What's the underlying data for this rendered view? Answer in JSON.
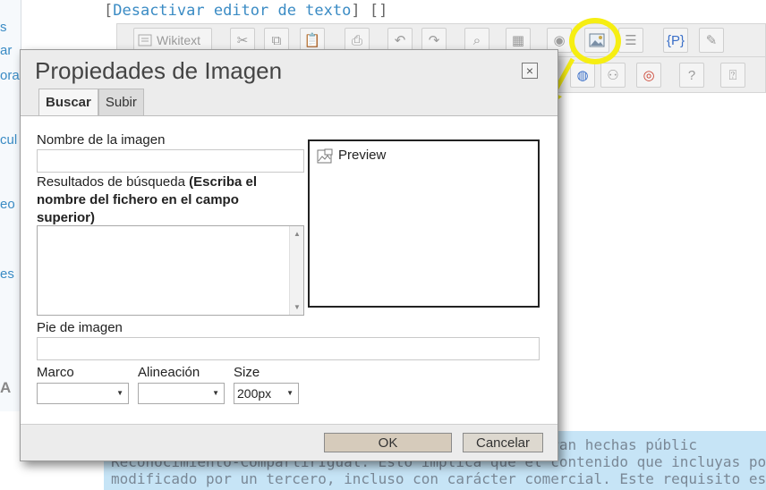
{
  "background": {
    "top_links": {
      "link": "Desactivar editor de texto",
      "open": "[",
      "close": "] []"
    },
    "left_fragments": [
      "s",
      "ar",
      "ora",
      "cul",
      "eo",
      "es",
      "A"
    ],
    "toolbar": {
      "wikitext_label": "Wikitext"
    },
    "notice_lines": [
      "Este contenido puede reutilizarse porque se consideran hechas públic",
      "Reconocimiento-CompartirIgual. Esto implica que el contenido que incluyas podr",
      "modificado por un tercero, incluso con carácter comercial. Este requisito es uno de lo"
    ]
  },
  "dialog": {
    "title": "Propiedades de Imagen",
    "close_glyph": "×",
    "tabs": [
      {
        "label": "Buscar",
        "active": true
      },
      {
        "label": "Subir",
        "active": false
      }
    ],
    "image_name_label": "Nombre de la imagen",
    "image_name_value": "",
    "results_label": "Resultados de búsqueda",
    "results_hint": "(Escriba el nombre del fichero en el campo superior)",
    "preview_label": "Preview",
    "caption_label": "Pie de imagen",
    "caption_value": "",
    "frame_label": "Marco",
    "frame_value": "",
    "align_label": "Alineación",
    "align_value": "",
    "size_label": "Size",
    "size_value": "200px",
    "ok_label": "OK",
    "cancel_label": "Cancelar"
  },
  "colors": {
    "highlight": "#f6ee12",
    "notice_bg": "#c6e4f6",
    "link": "#3a8bc4",
    "ok_button": "#d6cbbb"
  },
  "icons": [
    "image-icon",
    "close-icon",
    "cut-icon",
    "copy-icon",
    "paste-icon",
    "print-icon",
    "undo-icon",
    "redo-icon",
    "help-icon"
  ]
}
